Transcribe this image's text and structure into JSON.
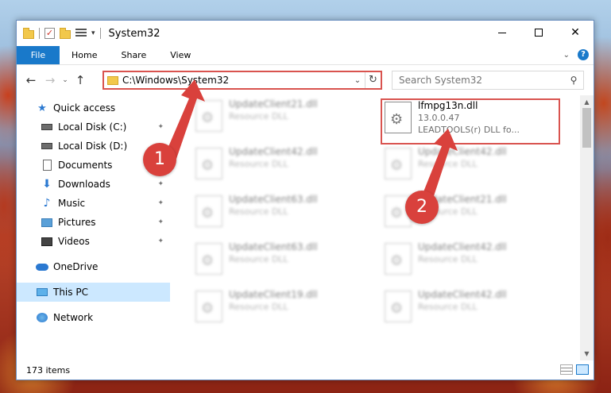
{
  "titlebar": {
    "title": "System32",
    "qa_dropdown": "▾",
    "min_label": "",
    "max_label": "",
    "close_label": "✕"
  },
  "ribbon": {
    "tabs": [
      "File",
      "Home",
      "Share",
      "View"
    ],
    "chevron": "⌄",
    "help": "?"
  },
  "navigation": {
    "back": "←",
    "forward": "→",
    "recent": "⌄",
    "up": "↑",
    "address": "C:\\Windows\\System32",
    "address_dropdown": "⌄",
    "refresh": "↻",
    "search_placeholder": "Search System32",
    "search_icon": "⚲"
  },
  "sidebar": {
    "items": [
      {
        "label": "Quick access",
        "icon": "star-icon",
        "pinned": false
      },
      {
        "label": "Local Disk (C:)",
        "icon": "drive-icon",
        "pinned": true
      },
      {
        "label": "Local Disk (D:)",
        "icon": "drive-icon",
        "pinned": false
      },
      {
        "label": "Documents",
        "icon": "documents-icon",
        "pinned": true
      },
      {
        "label": "Downloads",
        "icon": "download-icon",
        "pinned": true
      },
      {
        "label": "Music",
        "icon": "music-icon",
        "pinned": true
      },
      {
        "label": "Pictures",
        "icon": "pictures-icon",
        "pinned": true
      },
      {
        "label": "Videos",
        "icon": "videos-icon",
        "pinned": true
      },
      {
        "label": "OneDrive",
        "icon": "cloud-icon",
        "pinned": false
      },
      {
        "label": "This PC",
        "icon": "computer-icon",
        "pinned": false,
        "selected": true
      },
      {
        "label": "Network",
        "icon": "network-icon",
        "pinned": false
      }
    ],
    "pin_glyph": "📌"
  },
  "files": {
    "column1": [
      {
        "name": "UpdateClient21.dll",
        "type": "Resource DLL"
      },
      {
        "name": "UpdateClient42.dll",
        "type": "Resource DLL"
      },
      {
        "name": "UpdateClient63.dll",
        "type": "Resource DLL"
      },
      {
        "name": "UpdateClient63.dll",
        "type": "Resource DLL"
      },
      {
        "name": "UpdateClient19.dll",
        "type": "Resource DLL"
      }
    ],
    "column2": [
      {
        "name": "lfmpg13n.dll",
        "version": "13.0.0.47",
        "type": "LEADTOOLS(r) DLL fo..."
      },
      {
        "name": "UpdateClient42.dll",
        "type": "Resource DLL"
      },
      {
        "name": "UpdateClient21.dll",
        "type": "Resource DLL"
      },
      {
        "name": "UpdateClient42.dll",
        "type": "Resource DLL"
      },
      {
        "name": "UpdateClient42.dll",
        "type": "Resource DLL"
      }
    ]
  },
  "status": {
    "item_count": "173 items"
  },
  "callouts": {
    "step1": "1",
    "step2": "2",
    "color": "#d9413c"
  },
  "colors": {
    "accent": "#1979ca",
    "selection": "#cce8ff",
    "highlight_border": "#d9534f"
  }
}
